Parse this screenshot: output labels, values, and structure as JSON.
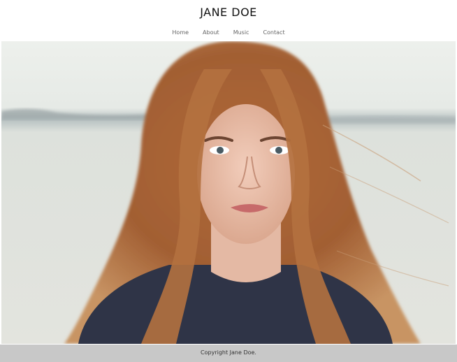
{
  "header": {
    "site_title": "JANE DOE"
  },
  "nav": {
    "items": [
      {
        "label": "Home"
      },
      {
        "label": "About"
      },
      {
        "label": "Music"
      },
      {
        "label": "Contact"
      }
    ]
  },
  "hero": {
    "image_alt": "portrait photo"
  },
  "footer": {
    "copyright": "Copyright Jane Doe."
  },
  "colors": {
    "header_bg": "#ffffff",
    "footer_bg": "#c8c8c8",
    "nav_text": "#666666",
    "title_text": "#111111"
  }
}
